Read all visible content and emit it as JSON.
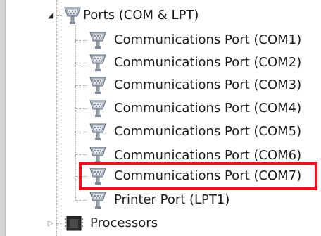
{
  "tree": {
    "ports_group": {
      "label": "Ports (COM & LPT)",
      "expanded": true,
      "icon": "serial-port-icon",
      "children": [
        {
          "label": "Communications Port (COM1)",
          "icon": "serial-port-icon"
        },
        {
          "label": "Communications Port (COM2)",
          "icon": "serial-port-icon"
        },
        {
          "label": "Communications Port (COM3)",
          "icon": "serial-port-icon"
        },
        {
          "label": "Communications Port (COM4)",
          "icon": "serial-port-icon"
        },
        {
          "label": "Communications Port (COM5)",
          "icon": "serial-port-icon"
        },
        {
          "label": "Communications Port (COM6)",
          "icon": "serial-port-icon"
        },
        {
          "label": "Communications Port (COM7)",
          "icon": "serial-port-icon",
          "highlighted": true
        },
        {
          "label": "Printer Port (LPT1)",
          "icon": "serial-port-icon"
        }
      ]
    },
    "processors_group": {
      "label": "Processors",
      "expanded": false,
      "icon": "processor-chip-icon"
    }
  },
  "colors": {
    "highlight_border": "#e8131e",
    "text": "#1a1a1a",
    "tree_line": "#a0a0a0"
  }
}
